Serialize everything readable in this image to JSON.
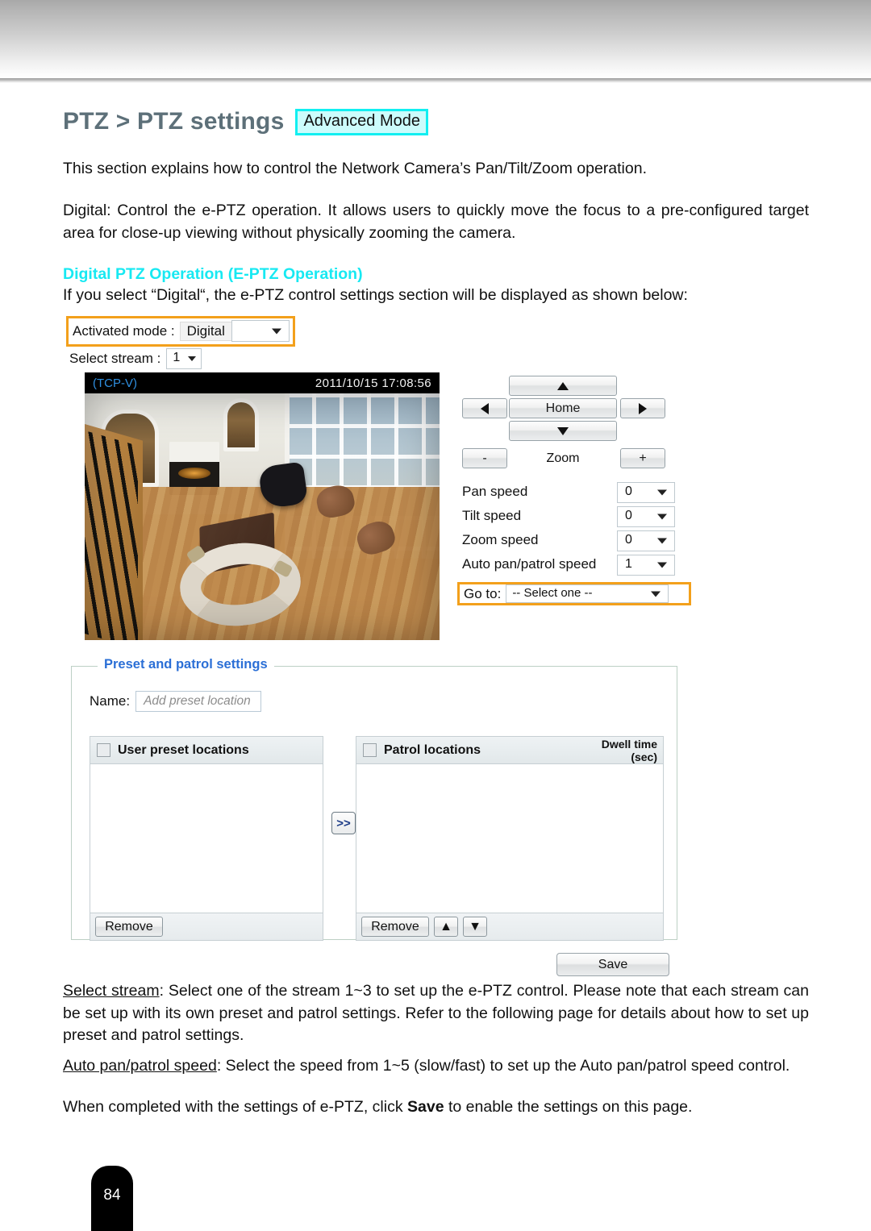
{
  "page": {
    "title_main": "PTZ > PTZ settings",
    "advanced_mode_badge": "Advanced Mode",
    "page_number": "84",
    "accent_heading_color": "#17e9f2",
    "title_color": "#5d7079",
    "highlight_color": "#f3a01b",
    "legend_color": "#2b6fd6"
  },
  "body": {
    "intro": "This section explains how to control the Network Camera’s Pan/Tilt/Zoom operation.",
    "digital_paragraph": "Digital: Control the e-PTZ operation. It allows users to quickly move the focus to a pre-configured target area for close-up viewing without physically zooming the camera.",
    "section_heading": "Digital PTZ Operation (E-PTZ Operation)",
    "section_intro": "If you select “Digital“, the e-PTZ control settings section will be displayed as shown below:",
    "select_stream_term": "Select stream",
    "select_stream_desc": ": Select one of the stream 1~3 to set up the e-PTZ control. Please note that each stream can be set up with its own preset and patrol settings. Refer to the following page for details about how to set up preset and patrol settings.",
    "auto_pan_term": "Auto pan/patrol speed",
    "auto_pan_desc": ": Select the speed from 1~5 (slow/fast) to set up the Auto pan/patrol speed control.",
    "completed_pre": "When completed with the settings of e-PTZ, click ",
    "completed_bold": "Save",
    "completed_post": " to enable the settings on this page."
  },
  "ui": {
    "activated_mode": {
      "label": "Activated mode :",
      "value": "Digital"
    },
    "select_stream": {
      "label": "Select stream :",
      "value": "1"
    },
    "video": {
      "protocol": "(TCP-V)",
      "timestamp": "2011/10/15  17:08:56"
    },
    "ptz_pad": {
      "up": "▲",
      "left": "◀",
      "home": "Home",
      "right": "▶",
      "down": "▼",
      "zoom_out": "-",
      "zoom_label": "Zoom",
      "zoom_in": "+"
    },
    "speeds": [
      {
        "name": "Pan speed",
        "value": "0"
      },
      {
        "name": "Tilt speed",
        "value": "0"
      },
      {
        "name": "Zoom speed",
        "value": "0"
      },
      {
        "name": "Auto pan/patrol speed",
        "value": "1"
      }
    ],
    "goto": {
      "label": "Go to:",
      "value": "-- Select one --"
    },
    "preset_patrol": {
      "legend": "Preset and patrol settings",
      "name_label": "Name:",
      "name_placeholder": "Add preset location",
      "user_preset_title": "User preset locations",
      "patrol_title": "Patrol locations",
      "dwell_line1": "Dwell time",
      "dwell_line2": "(sec)",
      "transfer_label": ">>",
      "remove_left": "Remove",
      "remove_right": "Remove",
      "move_up": "▲",
      "move_down": "▼",
      "user_preset_items": [],
      "patrol_items": []
    },
    "save_button": "Save"
  }
}
